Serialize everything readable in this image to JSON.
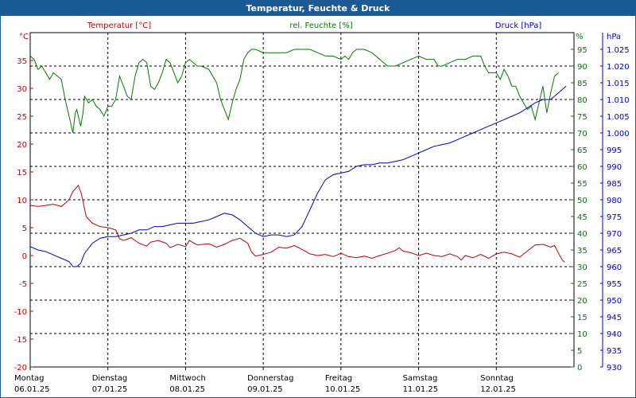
{
  "window": {
    "title": "Temperatur, Feuchte & Druck"
  },
  "colors": {
    "temperature": "#c00000",
    "humidity": "#007800",
    "pressure": "#0000c0",
    "title_bar": "#1c5a96",
    "grid": "#000000"
  },
  "chart_data": {
    "type": "line",
    "title": "Temperatur, Feuchte & Druck",
    "grid": true,
    "x_days": [
      {
        "weekday": "Montag",
        "date": "06.01.25"
      },
      {
        "weekday": "Dienstag",
        "date": "07.01.25"
      },
      {
        "weekday": "Mittwoch",
        "date": "08.01.25"
      },
      {
        "weekday": "Donnerstag",
        "date": "09.01.25"
      },
      {
        "weekday": "Freitag",
        "date": "10.01.25"
      },
      {
        "weekday": "Samstag",
        "date": "11.01.25"
      },
      {
        "weekday": "Sonntag",
        "date": "12.01.25"
      }
    ],
    "x_range_days": [
      0,
      7
    ],
    "axes": {
      "left": {
        "label": "Temperatur [°C]",
        "unit": "°C",
        "range": [
          -20,
          40
        ],
        "ticks": [
          "35",
          "30",
          "25",
          "20",
          "15",
          "10",
          "5",
          "0",
          "-5",
          "-10",
          "-15",
          "-20"
        ],
        "tick_values": [
          35,
          30,
          25,
          20,
          15,
          10,
          5,
          0,
          -5,
          -10,
          -15,
          -20
        ]
      },
      "middle": {
        "label": "rel. Feuchte [%]",
        "unit": "%",
        "range": [
          0,
          100
        ],
        "ticks": [
          "95",
          "90",
          "85",
          "80",
          "75",
          "70",
          "65",
          "60",
          "55",
          "50",
          "45",
          "40",
          "35",
          "30",
          "25",
          "20",
          "15",
          "10",
          "5",
          "0"
        ],
        "tick_values": [
          95,
          90,
          85,
          80,
          75,
          70,
          65,
          60,
          55,
          50,
          45,
          40,
          35,
          30,
          25,
          20,
          15,
          10,
          5,
          0
        ]
      },
      "right": {
        "label": "Druck [hPa]",
        "unit": "hPa",
        "range": [
          930,
          1030
        ],
        "ticks": [
          "1.025",
          "1.020",
          "1.015",
          "1.010",
          "1.005",
          "1.000",
          "995",
          "990",
          "985",
          "980",
          "975",
          "970",
          "965",
          "960",
          "955",
          "950",
          "945",
          "940",
          "935",
          "930"
        ],
        "tick_values": [
          1025,
          1020,
          1015,
          1010,
          1005,
          1000,
          995,
          990,
          985,
          980,
          975,
          970,
          965,
          960,
          955,
          950,
          945,
          940,
          935,
          930
        ]
      }
    },
    "series": [
      {
        "name": "Temperatur [°C]",
        "axis": "left",
        "color": "#c00000",
        "points": [
          [
            0,
            9
          ],
          [
            0.1,
            8.8
          ],
          [
            0.2,
            9
          ],
          [
            0.3,
            9.2
          ],
          [
            0.4,
            8.8
          ],
          [
            0.5,
            10
          ],
          [
            0.55,
            11.5
          ],
          [
            0.62,
            12.6
          ],
          [
            0.66,
            11
          ],
          [
            0.72,
            7
          ],
          [
            0.8,
            5.8
          ],
          [
            0.9,
            5.2
          ],
          [
            1.0,
            5
          ],
          [
            1.1,
            4.6
          ],
          [
            1.15,
            3
          ],
          [
            1.2,
            2.7
          ],
          [
            1.3,
            3.2
          ],
          [
            1.4,
            2.2
          ],
          [
            1.5,
            1.7
          ],
          [
            1.55,
            2.4
          ],
          [
            1.65,
            2.7
          ],
          [
            1.75,
            2.2
          ],
          [
            1.8,
            1.4
          ],
          [
            1.9,
            2
          ],
          [
            2.0,
            1.6
          ],
          [
            2.05,
            2.7
          ],
          [
            2.15,
            1.9
          ],
          [
            2.3,
            2.1
          ],
          [
            2.4,
            1.5
          ],
          [
            2.5,
            2
          ],
          [
            2.6,
            2.7
          ],
          [
            2.7,
            3.1
          ],
          [
            2.8,
            2.2
          ],
          [
            2.85,
            0.6
          ],
          [
            2.9,
            -0.1
          ],
          [
            3.0,
            0.2
          ],
          [
            3.1,
            0.6
          ],
          [
            3.2,
            1.5
          ],
          [
            3.3,
            1.3
          ],
          [
            3.4,
            1.8
          ],
          [
            3.5,
            1.1
          ],
          [
            3.6,
            0.3
          ],
          [
            3.7,
            0
          ],
          [
            3.8,
            0.2
          ],
          [
            3.9,
            -0.2
          ],
          [
            4.0,
            0.4
          ],
          [
            4.1,
            -0.2
          ],
          [
            4.2,
            -0.4
          ],
          [
            4.3,
            -0.1
          ],
          [
            4.4,
            -0.5
          ],
          [
            4.5,
            0
          ],
          [
            4.6,
            0.4
          ],
          [
            4.7,
            0.9
          ],
          [
            4.75,
            1.4
          ],
          [
            4.8,
            0.8
          ],
          [
            4.9,
            0.5
          ],
          [
            5.0,
            0
          ],
          [
            5.1,
            0.4
          ],
          [
            5.2,
            0
          ],
          [
            5.3,
            -0.2
          ],
          [
            5.4,
            0.3
          ],
          [
            5.5,
            -0.2
          ],
          [
            5.55,
            -0.8
          ],
          [
            5.6,
            0
          ],
          [
            5.7,
            -0.4
          ],
          [
            5.8,
            0.2
          ],
          [
            5.9,
            -0.5
          ],
          [
            6.0,
            0.3
          ],
          [
            6.1,
            0.6
          ],
          [
            6.2,
            0.3
          ],
          [
            6.3,
            -0.3
          ],
          [
            6.4,
            0.8
          ],
          [
            6.5,
            1.9
          ],
          [
            6.6,
            2
          ],
          [
            6.7,
            1.5
          ],
          [
            6.75,
            1.8
          ],
          [
            6.8,
            0.4
          ],
          [
            6.85,
            -0.8
          ],
          [
            6.88,
            -1.2
          ]
        ]
      },
      {
        "name": "rel. Feuchte [%]",
        "axis": "middle",
        "color": "#007800",
        "points": [
          [
            0,
            93
          ],
          [
            0.05,
            92
          ],
          [
            0.1,
            89
          ],
          [
            0.15,
            90
          ],
          [
            0.2,
            88
          ],
          [
            0.25,
            86
          ],
          [
            0.3,
            88
          ],
          [
            0.35,
            87
          ],
          [
            0.4,
            86
          ],
          [
            0.45,
            80
          ],
          [
            0.5,
            75
          ],
          [
            0.55,
            70
          ],
          [
            0.58,
            76
          ],
          [
            0.6,
            77
          ],
          [
            0.65,
            72
          ],
          [
            0.68,
            76
          ],
          [
            0.7,
            81
          ],
          [
            0.75,
            79
          ],
          [
            0.8,
            80
          ],
          [
            0.85,
            78
          ],
          [
            0.9,
            77
          ],
          [
            0.95,
            75
          ],
          [
            1.0,
            78
          ],
          [
            1.05,
            78
          ],
          [
            1.1,
            80
          ],
          [
            1.15,
            87
          ],
          [
            1.2,
            84
          ],
          [
            1.25,
            81
          ],
          [
            1.3,
            80
          ],
          [
            1.35,
            87
          ],
          [
            1.4,
            91
          ],
          [
            1.45,
            92
          ],
          [
            1.5,
            91
          ],
          [
            1.55,
            84
          ],
          [
            1.6,
            83
          ],
          [
            1.65,
            85
          ],
          [
            1.7,
            88
          ],
          [
            1.75,
            92
          ],
          [
            1.8,
            91
          ],
          [
            1.85,
            88
          ],
          [
            1.9,
            85
          ],
          [
            1.95,
            87
          ],
          [
            2.0,
            91
          ],
          [
            2.05,
            92
          ],
          [
            2.1,
            91
          ],
          [
            2.15,
            90
          ],
          [
            2.2,
            90
          ],
          [
            2.3,
            89
          ],
          [
            2.4,
            85
          ],
          [
            2.45,
            80
          ],
          [
            2.5,
            77
          ],
          [
            2.55,
            74
          ],
          [
            2.6,
            79
          ],
          [
            2.65,
            83
          ],
          [
            2.7,
            86
          ],
          [
            2.75,
            92
          ],
          [
            2.8,
            94
          ],
          [
            2.85,
            95
          ],
          [
            2.9,
            95
          ],
          [
            3.0,
            94
          ],
          [
            3.1,
            94
          ],
          [
            3.2,
            94
          ],
          [
            3.3,
            94
          ],
          [
            3.4,
            95
          ],
          [
            3.5,
            95
          ],
          [
            3.6,
            95
          ],
          [
            3.7,
            94
          ],
          [
            3.8,
            93
          ],
          [
            3.9,
            93
          ],
          [
            4.0,
            92
          ],
          [
            4.05,
            93
          ],
          [
            4.1,
            92
          ],
          [
            4.15,
            94
          ],
          [
            4.2,
            95
          ],
          [
            4.3,
            95
          ],
          [
            4.4,
            94
          ],
          [
            4.5,
            92
          ],
          [
            4.6,
            90
          ],
          [
            4.7,
            90
          ],
          [
            4.8,
            91
          ],
          [
            4.9,
            92
          ],
          [
            5.0,
            93
          ],
          [
            5.1,
            92
          ],
          [
            5.2,
            92
          ],
          [
            5.25,
            90
          ],
          [
            5.3,
            90
          ],
          [
            5.4,
            91
          ],
          [
            5.5,
            92
          ],
          [
            5.6,
            92
          ],
          [
            5.7,
            93
          ],
          [
            5.8,
            93
          ],
          [
            5.85,
            90
          ],
          [
            5.9,
            88
          ],
          [
            6.0,
            88
          ],
          [
            6.05,
            86
          ],
          [
            6.1,
            89
          ],
          [
            6.15,
            87
          ],
          [
            6.2,
            84
          ],
          [
            6.25,
            84
          ],
          [
            6.3,
            81
          ],
          [
            6.35,
            79
          ],
          [
            6.4,
            77
          ],
          [
            6.45,
            78
          ],
          [
            6.5,
            74
          ],
          [
            6.55,
            79
          ],
          [
            6.6,
            84
          ],
          [
            6.65,
            76
          ],
          [
            6.7,
            82
          ],
          [
            6.75,
            87
          ],
          [
            6.8,
            88
          ]
        ]
      },
      {
        "name": "Druck [hPa]",
        "axis": "right",
        "color": "#0000c0",
        "points": [
          [
            0,
            966
          ],
          [
            0.1,
            965
          ],
          [
            0.2,
            964.5
          ],
          [
            0.3,
            963.5
          ],
          [
            0.4,
            962.5
          ],
          [
            0.5,
            961.5
          ],
          [
            0.55,
            960
          ],
          [
            0.6,
            960
          ],
          [
            0.65,
            961
          ],
          [
            0.7,
            964
          ],
          [
            0.8,
            967
          ],
          [
            0.9,
            968.5
          ],
          [
            1.0,
            969
          ],
          [
            1.1,
            969
          ],
          [
            1.2,
            969.5
          ],
          [
            1.3,
            970
          ],
          [
            1.4,
            971
          ],
          [
            1.5,
            971
          ],
          [
            1.6,
            972
          ],
          [
            1.7,
            972
          ],
          [
            1.8,
            972.5
          ],
          [
            1.9,
            973
          ],
          [
            2.0,
            973
          ],
          [
            2.1,
            973
          ],
          [
            2.2,
            973.5
          ],
          [
            2.3,
            974
          ],
          [
            2.4,
            975
          ],
          [
            2.5,
            976
          ],
          [
            2.6,
            975.5
          ],
          [
            2.7,
            974
          ],
          [
            2.8,
            972
          ],
          [
            2.9,
            970
          ],
          [
            3.0,
            969
          ],
          [
            3.1,
            969.5
          ],
          [
            3.2,
            969.5
          ],
          [
            3.3,
            969
          ],
          [
            3.4,
            969.5
          ],
          [
            3.5,
            972
          ],
          [
            3.6,
            977
          ],
          [
            3.7,
            982
          ],
          [
            3.8,
            986
          ],
          [
            3.9,
            987.5
          ],
          [
            4.0,
            988
          ],
          [
            4.1,
            988.5
          ],
          [
            4.2,
            990
          ],
          [
            4.3,
            990.5
          ],
          [
            4.4,
            990.5
          ],
          [
            4.5,
            991
          ],
          [
            4.6,
            991
          ],
          [
            4.7,
            991.5
          ],
          [
            4.8,
            992
          ],
          [
            4.9,
            993
          ],
          [
            5.0,
            994
          ],
          [
            5.1,
            995
          ],
          [
            5.2,
            996
          ],
          [
            5.3,
            996.5
          ],
          [
            5.4,
            997
          ],
          [
            5.5,
            998
          ],
          [
            5.6,
            999
          ],
          [
            5.7,
            1000
          ],
          [
            5.8,
            1001
          ],
          [
            5.9,
            1002
          ],
          [
            6.0,
            1003
          ],
          [
            6.1,
            1004
          ],
          [
            6.2,
            1005
          ],
          [
            6.3,
            1006
          ],
          [
            6.4,
            1007.5
          ],
          [
            6.5,
            1009
          ],
          [
            6.6,
            1010
          ],
          [
            6.7,
            1010
          ],
          [
            6.75,
            1011
          ],
          [
            6.8,
            1012
          ],
          [
            6.85,
            1013
          ],
          [
            6.9,
            1014
          ]
        ]
      }
    ]
  }
}
